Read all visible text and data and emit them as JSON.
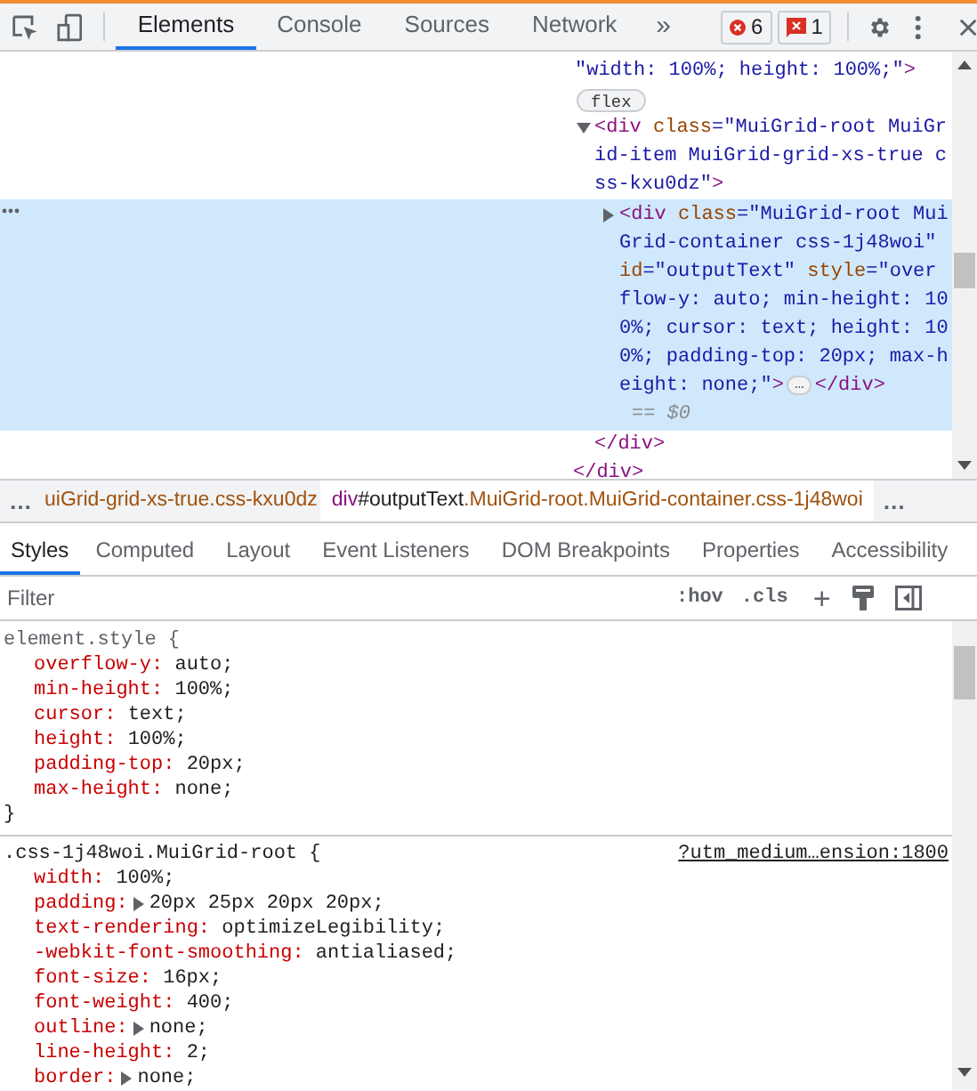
{
  "toolbar": {
    "tabs": [
      {
        "label": "Elements",
        "selected": true
      },
      {
        "label": "Console",
        "selected": false
      },
      {
        "label": "Sources",
        "selected": false
      },
      {
        "label": "Network",
        "selected": false
      }
    ],
    "more": "»",
    "badges": [
      {
        "kind": "error",
        "count": "6"
      },
      {
        "kind": "issue",
        "count": "1"
      }
    ]
  },
  "dom": {
    "items": [
      {
        "kind": "text",
        "tokens": [
          {
            "kind": "value",
            "text": "\"width: 100%; height: 100%;\""
          },
          {
            "kind": "tag",
            "text": ">"
          }
        ]
      },
      {
        "kind": "badge",
        "text": "flex"
      },
      {
        "kind": "element",
        "expanded": true,
        "selected": false,
        "tokens": [
          {
            "kind": "tag",
            "text": "<div"
          },
          {
            "kind": "attr",
            "text": " class"
          },
          {
            "kind": "value",
            "text": "=\"MuiGrid-root MuiGrid-item MuiGrid-grid-xs-true css-kxu0dz\""
          },
          {
            "kind": "tag",
            "text": ">"
          }
        ],
        "children": [
          {
            "kind": "element",
            "expanded": false,
            "selected": true,
            "tokens": [
              {
                "kind": "tag",
                "text": "<div"
              },
              {
                "kind": "attr",
                "text": " class"
              },
              {
                "kind": "value",
                "text": "=\"MuiGrid-root MuiGrid-container css-1j48woi\""
              },
              {
                "kind": "attr",
                "text": " id"
              },
              {
                "kind": "value",
                "text": "=\"outputText\""
              },
              {
                "kind": "attr",
                "text": " style"
              },
              {
                "kind": "value",
                "text": "=\"overflow-y: auto; min-height: 100%; cursor: text; height: 100%; padding-top: 20px; max-height: none;\""
              },
              {
                "kind": "tag",
                "text": ">"
              }
            ],
            "ellipsis": "…",
            "close": "</div>",
            "marker": "== $0"
          }
        ],
        "close": "</div>"
      },
      {
        "kind": "close",
        "text": "</div>"
      }
    ]
  },
  "breadcrumbs": {
    "more_left": "…",
    "more_right": "…",
    "items": [
      {
        "selected": false,
        "parts": [
          {
            "kind": "class",
            "text": "uiGrid-grid-xs-true.css-kxu0dz"
          }
        ]
      },
      {
        "selected": true,
        "parts": [
          {
            "kind": "tag",
            "text": "div"
          },
          {
            "kind": "id",
            "text": "#outputText"
          },
          {
            "kind": "class",
            "text": ".MuiGrid-root.MuiGrid-container.css-1j48woi"
          }
        ]
      }
    ]
  },
  "sidebar_tabs": [
    {
      "label": "Styles",
      "selected": true
    },
    {
      "label": "Computed",
      "selected": false
    },
    {
      "label": "Layout",
      "selected": false
    },
    {
      "label": "Event Listeners",
      "selected": false
    },
    {
      "label": "DOM Breakpoints",
      "selected": false
    },
    {
      "label": "Properties",
      "selected": false
    },
    {
      "label": "Accessibility",
      "selected": false
    }
  ],
  "filter": {
    "placeholder": "Filter",
    "hov": ":hov",
    "cls": ".cls",
    "add": "+"
  },
  "rules": [
    {
      "selector": "element.style {",
      "close": "}",
      "declarations": [
        {
          "name": "overflow-y:",
          "value": "auto;",
          "expandable": false
        },
        {
          "name": "min-height:",
          "value": "100%;",
          "expandable": false
        },
        {
          "name": "cursor:",
          "value": "text;",
          "expandable": false
        },
        {
          "name": "height:",
          "value": "100%;",
          "expandable": false
        },
        {
          "name": "padding-top:",
          "value": "20px;",
          "expandable": false
        },
        {
          "name": "max-height:",
          "value": "none;",
          "expandable": false
        }
      ]
    },
    {
      "selector": ".css-1j48woi.MuiGrid-root {",
      "source": "?utm_medium…ension:1800",
      "declarations": [
        {
          "name": "width:",
          "value": "100%;",
          "expandable": false
        },
        {
          "name": "padding:",
          "value": "20px 25px 20px 20px;",
          "expandable": true
        },
        {
          "name": "text-rendering:",
          "value": "optimizeLegibility;",
          "expandable": false
        },
        {
          "name": "-webkit-font-smoothing:",
          "value": "antialiased;",
          "expandable": false
        },
        {
          "name": "font-size:",
          "value": "16px;",
          "expandable": false
        },
        {
          "name": "font-weight:",
          "value": "400;",
          "expandable": false
        },
        {
          "name": "outline:",
          "value": "none;",
          "expandable": true
        },
        {
          "name": "line-height:",
          "value": "2;",
          "expandable": false
        },
        {
          "name": "border:",
          "value": "none;",
          "expandable": true
        }
      ]
    }
  ]
}
